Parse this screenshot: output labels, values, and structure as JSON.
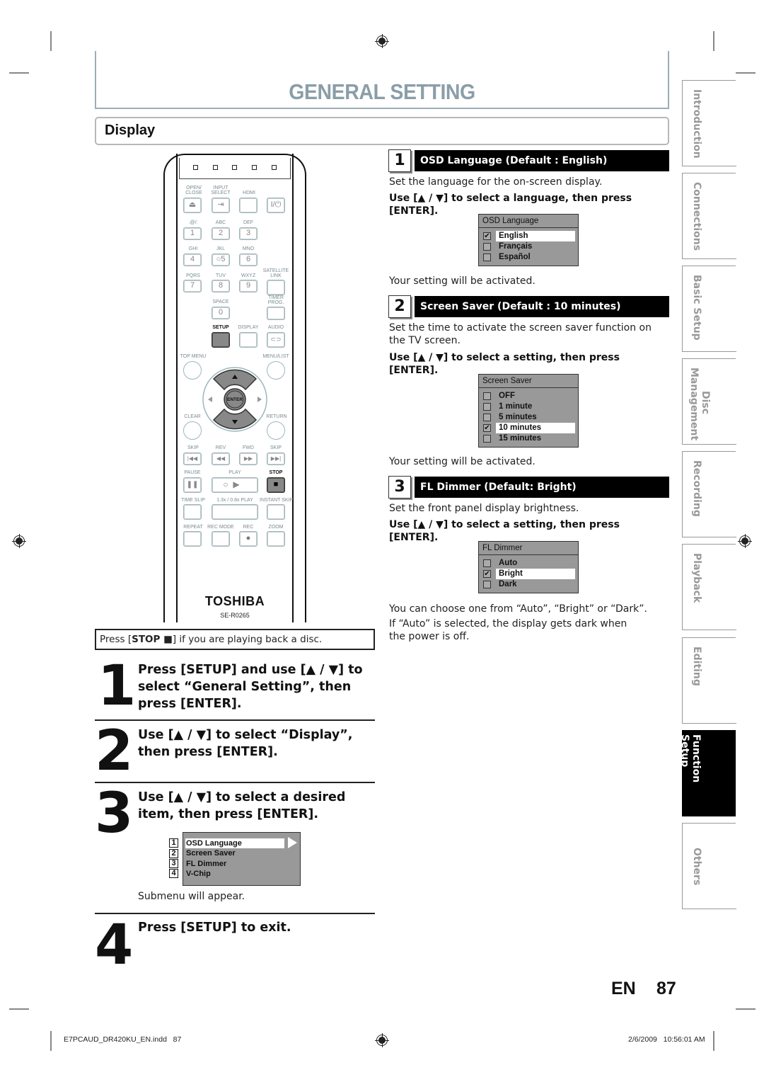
{
  "header": {
    "page_title": "GENERAL SETTING",
    "section_title": "Display"
  },
  "remote": {
    "top_labels": [
      "OPEN/\nCLOSE",
      "INPUT\nSELECT",
      "HDMI"
    ],
    "power_label": "I/⏻",
    "key_labels": [
      ".@/:",
      "ABC",
      "DEF",
      "GHI",
      "JKL",
      "MNO",
      "PQRS",
      "TUV",
      "WXYZ"
    ],
    "keys": [
      "1",
      "2",
      "3",
      "4",
      "○5",
      "6",
      "7",
      "8",
      "9",
      "0"
    ],
    "satellite_link": "SATELLITE\nLINK",
    "timer_prog": "TIMER\nPROG.",
    "space": "SPACE",
    "setup": "SETUP",
    "display": "DISPLAY",
    "audio": "AUDIO",
    "top_menu": "TOP MENU",
    "menu_list": "MENU/LIST",
    "enter": "ENTER",
    "clear": "CLEAR",
    "return": "RETURN",
    "skip_back": "SKIP",
    "rev": "REV",
    "fwd": "FWD",
    "skip_fwd": "SKIP",
    "pause": "PAUSE",
    "play": "PLAY",
    "stop": "STOP",
    "time_slip": "TIME SLIP",
    "slow_play": "1.3x / 0.8x PLAY",
    "instant_skip": "INSTANT SKIP",
    "repeat": "REPEAT",
    "rec_mode": "REC MODE",
    "rec": "REC",
    "zoom": "ZOOM",
    "brand": "TOSHIBA",
    "model": "SE-R0265"
  },
  "stop_note": {
    "prefix": "Press [",
    "key": "STOP ■",
    "suffix": "] if you are playing back a disc."
  },
  "steps": [
    {
      "number": "1",
      "text": "Press [SETUP] and use [▲ / ▼] to select “General Setting”, then press [ENTER]."
    },
    {
      "number": "2",
      "text": "Use [▲ / ▼] to select “Display”, then press [ENTER]."
    },
    {
      "number": "3",
      "text": "Use [▲ / ▼] to select a desired item, then press [ENTER].",
      "caption": "Submenu will appear."
    },
    {
      "number": "4",
      "text": "Press [SETUP] to exit."
    }
  ],
  "submenu": {
    "items": [
      {
        "num": "1",
        "label": "OSD Language",
        "selected": true
      },
      {
        "num": "2",
        "label": "Screen Saver",
        "selected": false
      },
      {
        "num": "3",
        "label": "FL Dimmer",
        "selected": false
      },
      {
        "num": "4",
        "label": "V-Chip",
        "selected": false
      }
    ]
  },
  "settings": [
    {
      "number": "1",
      "title": "OSD Language (Default : English)",
      "description": "Set the language for the on-screen display.",
      "instruction": "Use [▲ / ▼] to select a language, then press [ENTER].",
      "panel_title": "OSD Language",
      "options": [
        {
          "label": "English",
          "checked": true
        },
        {
          "label": "Français",
          "checked": false
        },
        {
          "label": "Español",
          "checked": false
        }
      ],
      "after": [
        "Your setting will be activated."
      ]
    },
    {
      "number": "2",
      "title": "Screen Saver (Default : 10 minutes)",
      "description": "Set the time to activate the screen saver function on the TV screen.",
      "instruction": "Use [▲ / ▼] to select a setting, then press [ENTER].",
      "panel_title": "Screen Saver",
      "options": [
        {
          "label": "OFF",
          "checked": false
        },
        {
          "label": "1 minute",
          "checked": false
        },
        {
          "label": "5 minutes",
          "checked": false
        },
        {
          "label": "10  minutes",
          "checked": true
        },
        {
          "label": "15  minutes",
          "checked": false
        }
      ],
      "after": [
        "Your setting will be activated."
      ]
    },
    {
      "number": "3",
      "title": "FL Dimmer (Default: Bright)",
      "description": "Set the front panel display brightness.",
      "instruction": "Use [▲ / ▼] to select a setting, then press [ENTER].",
      "panel_title": "FL Dimmer",
      "options": [
        {
          "label": "Auto",
          "checked": false
        },
        {
          "label": "Bright",
          "checked": true
        },
        {
          "label": "Dark",
          "checked": false
        }
      ],
      "after": [
        "You can choose one from “Auto”, “Bright” or “Dark”.",
        "If “Auto” is selected, the display gets dark when the power is off."
      ]
    }
  ],
  "side_tabs": [
    {
      "label": "Introduction",
      "active": false
    },
    {
      "label": "Connections",
      "active": false
    },
    {
      "label": "Basic Setup",
      "active": false
    },
    {
      "label": "Disc Management",
      "active": false
    },
    {
      "label": "Recording",
      "active": false
    },
    {
      "label": "Playback",
      "active": false
    },
    {
      "label": "Editing",
      "active": false
    },
    {
      "label": "Function Setup",
      "active": true
    },
    {
      "label": "Others",
      "active": false
    }
  ],
  "footer": {
    "language": "EN",
    "page_number": "87",
    "slug_file": "E7PCAUD_DR420KU_EN.indd   87",
    "slug_date": "2/6/2009   10:56:01 AM"
  },
  "colors": {
    "title_gray": "#8a9ea8",
    "frame_teal": "#9aaeb6",
    "osd_gray": "#999999",
    "active_tab": "#000000"
  }
}
